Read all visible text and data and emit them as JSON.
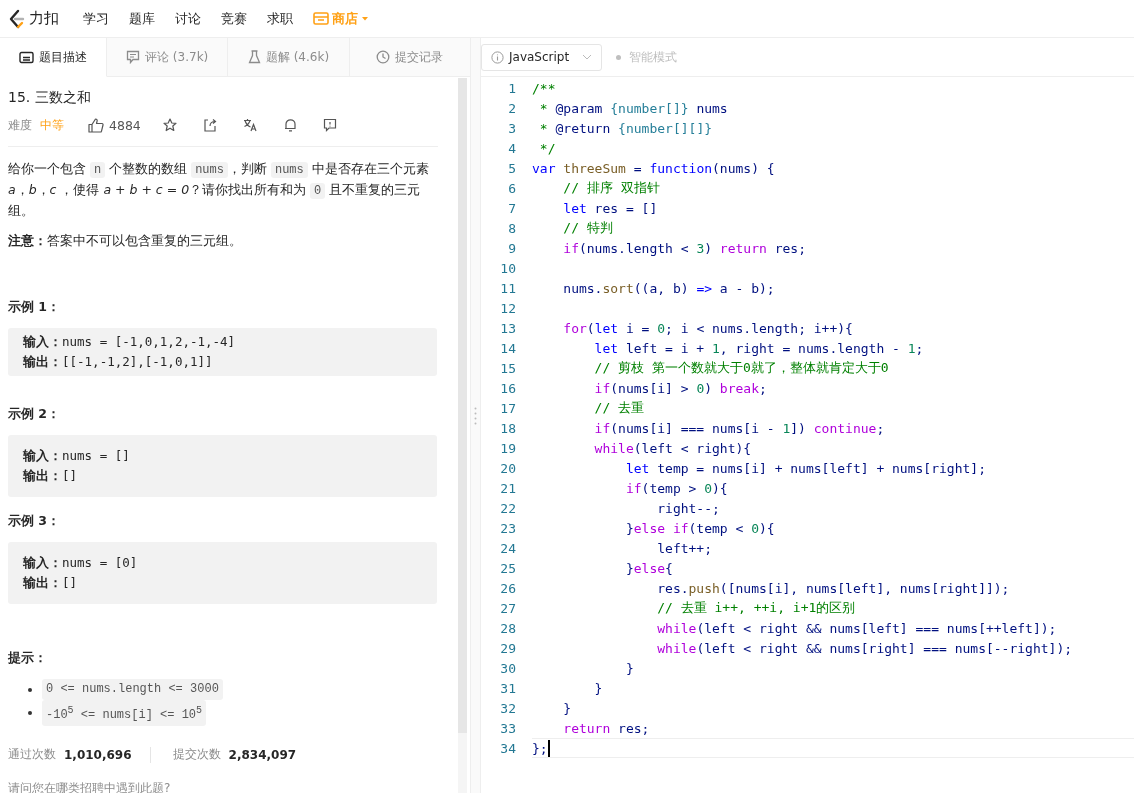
{
  "nav": {
    "logo": "力扣",
    "items": [
      {
        "label": "学习",
        "highlighted": false
      },
      {
        "label": "题库",
        "highlighted": false
      },
      {
        "label": "讨论",
        "highlighted": false
      },
      {
        "label": "竞赛",
        "highlighted": false
      },
      {
        "label": "求职",
        "highlighted": false
      },
      {
        "label": "商店",
        "highlighted": true
      }
    ]
  },
  "tabs": [
    {
      "label": "题目描述",
      "selected": true
    },
    {
      "label": "评论 (3.7k)",
      "selected": false
    },
    {
      "label": "题解 (4.6k)",
      "selected": false
    },
    {
      "label": "提交记录",
      "selected": false
    }
  ],
  "problem": {
    "title": "15. 三数之和",
    "difficulty_label": "难度",
    "difficulty": "中等",
    "likes": "4884",
    "description": [
      {
        "kind": "text",
        "text": "给你一个包含 "
      },
      {
        "kind": "code",
        "text": "n"
      },
      {
        "kind": "text",
        "text": " 个整数的数组 "
      },
      {
        "kind": "code",
        "text": "nums"
      },
      {
        "kind": "text",
        "text": "，判断 "
      },
      {
        "kind": "code",
        "text": "nums"
      },
      {
        "kind": "text",
        "text": " 中是否存在三个元素 *a*，*b*，*c* ，使得 *a + b + c = 0*？请你找出所有和为 "
      },
      {
        "kind": "code",
        "text": "0"
      },
      {
        "kind": "text",
        "text": " 且不重复的三元组。"
      }
    ],
    "note": "**注意：**答案中不可以包含重复的三元组。",
    "examples": [
      {
        "title": "示例 1：",
        "lines": [
          {
            "label": "输入：",
            "value": "nums = [-1,0,1,2,-1,-4]"
          },
          {
            "label": "输出：",
            "value": "[[-1,-1,2],[-1,0,1]]"
          }
        ]
      },
      {
        "title": "示例 2：",
        "lines": [
          {
            "label": "输入：",
            "value": "nums = []"
          },
          {
            "label": "输出：",
            "value": "[]"
          }
        ]
      },
      {
        "title": "示例 3：",
        "lines": [
          {
            "label": "输入：",
            "value": "nums = [0]"
          },
          {
            "label": "输出：",
            "value": "[]"
          }
        ]
      }
    ],
    "hints_title": "提示：",
    "hints": [
      "0 <= nums.length <= 3000",
      "-10$^{5}$ <= nums[i] <= 10$^{5}$"
    ],
    "stats": [
      {
        "label": "通过次数",
        "value": "1,010,696"
      },
      {
        "label": "提交次数",
        "value": "2,834,097"
      }
    ],
    "question": "请问您在哪类招聘中遇到此题?"
  },
  "editor": {
    "language": "JavaScript",
    "mode": {
      "label": "智能模式",
      "on": false
    },
    "lines": [
      {
        "number": "1",
        "active": false,
        "tokens": [
          {
            "kind": "cmt",
            "text": "/**"
          }
        ]
      },
      {
        "number": "2",
        "active": false,
        "tokens": [
          {
            "kind": "cmt",
            "text": " * "
          },
          {
            "kind": "plain",
            "text": "@param "
          },
          {
            "kind": "type",
            "text": "{number[]}"
          },
          {
            "kind": "plain",
            "text": " nums"
          }
        ]
      },
      {
        "number": "3",
        "active": false,
        "tokens": [
          {
            "kind": "cmt",
            "text": " * "
          },
          {
            "kind": "plain",
            "text": "@return "
          },
          {
            "kind": "type",
            "text": "{number[][]}"
          }
        ]
      },
      {
        "number": "4",
        "active": false,
        "tokens": [
          {
            "kind": "cmt",
            "text": " */"
          }
        ]
      },
      {
        "number": "5",
        "active": false,
        "tokens": [
          {
            "kind": "kw",
            "text": "var "
          },
          {
            "kind": "fn",
            "text": "threeSum"
          },
          {
            "kind": "plain",
            "text": " = "
          },
          {
            "kind": "kw",
            "text": "function"
          },
          {
            "kind": "plain",
            "text": "(nums) {"
          }
        ]
      },
      {
        "number": "6",
        "active": false,
        "tokens": [
          {
            "kind": "cmt",
            "text": "    // 排序 双指针"
          }
        ]
      },
      {
        "number": "7",
        "active": false,
        "tokens": [
          {
            "kind": "kw",
            "text": "    let"
          },
          {
            "kind": "plain",
            "text": " res = []"
          }
        ]
      },
      {
        "number": "8",
        "active": false,
        "tokens": [
          {
            "kind": "cmt",
            "text": "    // 特判"
          }
        ]
      },
      {
        "number": "9",
        "active": false,
        "tokens": [
          {
            "kind": "ctl",
            "text": "    if"
          },
          {
            "kind": "plain",
            "text": "(nums.length < "
          },
          {
            "kind": "num",
            "text": "3"
          },
          {
            "kind": "plain",
            "text": ") "
          },
          {
            "kind": "ctl",
            "text": "return"
          },
          {
            "kind": "plain",
            "text": " res;"
          }
        ]
      },
      {
        "number": "10",
        "active": false
      },
      {
        "number": "11",
        "active": false,
        "tokens": [
          {
            "kind": "plain",
            "text": "    nums."
          },
          {
            "kind": "fn",
            "text": "sort"
          },
          {
            "kind": "plain",
            "text": "((a, b) "
          },
          {
            "kind": "kw",
            "text": "=>"
          },
          {
            "kind": "plain",
            "text": " a - b);"
          }
        ]
      },
      {
        "number": "12",
        "active": false
      },
      {
        "number": "13",
        "active": false,
        "tokens": [
          {
            "kind": "ctl",
            "text": "    for"
          },
          {
            "kind": "plain",
            "text": "("
          },
          {
            "kind": "kw",
            "text": "let"
          },
          {
            "kind": "plain",
            "text": " i = "
          },
          {
            "kind": "num",
            "text": "0"
          },
          {
            "kind": "plain",
            "text": "; i < nums.length; i++){"
          }
        ]
      },
      {
        "number": "14",
        "active": false,
        "tokens": [
          {
            "kind": "kw",
            "text": "        let"
          },
          {
            "kind": "plain",
            "text": " left = i + "
          },
          {
            "kind": "num",
            "text": "1"
          },
          {
            "kind": "plain",
            "text": ", right = nums.length - "
          },
          {
            "kind": "num",
            "text": "1"
          },
          {
            "kind": "plain",
            "text": ";"
          }
        ]
      },
      {
        "number": "15",
        "active": false,
        "tokens": [
          {
            "kind": "cmt",
            "text": "        // 剪枝 第一个数就大于0就了，整体就肯定大于0"
          }
        ]
      },
      {
        "number": "16",
        "active": false,
        "tokens": [
          {
            "kind": "ctl",
            "text": "        if"
          },
          {
            "kind": "plain",
            "text": "(nums[i] > "
          },
          {
            "kind": "num",
            "text": "0"
          },
          {
            "kind": "plain",
            "text": ") "
          },
          {
            "kind": "ctl",
            "text": "break"
          },
          {
            "kind": "plain",
            "text": ";"
          }
        ]
      },
      {
        "number": "17",
        "active": false,
        "tokens": [
          {
            "kind": "cmt",
            "text": "        // 去重"
          }
        ]
      },
      {
        "number": "18",
        "active": false,
        "tokens": [
          {
            "kind": "ctl",
            "text": "        if"
          },
          {
            "kind": "plain",
            "text": "(nums[i] === nums[i - "
          },
          {
            "kind": "num",
            "text": "1"
          },
          {
            "kind": "plain",
            "text": "]) "
          },
          {
            "kind": "ctl",
            "text": "continue"
          },
          {
            "kind": "plain",
            "text": ";"
          }
        ]
      },
      {
        "number": "19",
        "active": false,
        "tokens": [
          {
            "kind": "ctl",
            "text": "        while"
          },
          {
            "kind": "plain",
            "text": "(left < right){"
          }
        ]
      },
      {
        "number": "20",
        "active": false,
        "tokens": [
          {
            "kind": "kw",
            "text": "            let"
          },
          {
            "kind": "plain",
            "text": " temp = nums[i] + nums[left] + nums[right];"
          }
        ]
      },
      {
        "number": "21",
        "active": false,
        "tokens": [
          {
            "kind": "ctl",
            "text": "            if"
          },
          {
            "kind": "plain",
            "text": "(temp > "
          },
          {
            "kind": "num",
            "text": "0"
          },
          {
            "kind": "plain",
            "text": "){"
          }
        ]
      },
      {
        "number": "22",
        "active": false,
        "tokens": [
          {
            "kind": "plain",
            "text": "                right--;"
          }
        ]
      },
      {
        "number": "23",
        "active": false,
        "tokens": [
          {
            "kind": "plain",
            "text": "            }"
          },
          {
            "kind": "ctl",
            "text": "else if"
          },
          {
            "kind": "plain",
            "text": "(temp < "
          },
          {
            "kind": "num",
            "text": "0"
          },
          {
            "kind": "plain",
            "text": "){"
          }
        ]
      },
      {
        "number": "24",
        "active": false,
        "tokens": [
          {
            "kind": "plain",
            "text": "                left++;"
          }
        ]
      },
      {
        "number": "25",
        "active": false,
        "tokens": [
          {
            "kind": "plain",
            "text": "            }"
          },
          {
            "kind": "ctl",
            "text": "else"
          },
          {
            "kind": "plain",
            "text": "{"
          }
        ]
      },
      {
        "number": "26",
        "active": false,
        "tokens": [
          {
            "kind": "plain",
            "text": "                res."
          },
          {
            "kind": "fn",
            "text": "push"
          },
          {
            "kind": "plain",
            "text": "([nums[i], nums[left], nums[right]]);"
          }
        ]
      },
      {
        "number": "27",
        "active": false,
        "tokens": [
          {
            "kind": "cmt",
            "text": "                // 去重 i++, ++i, i+1的区别"
          }
        ]
      },
      {
        "number": "28",
        "active": false,
        "tokens": [
          {
            "kind": "ctl",
            "text": "                while"
          },
          {
            "kind": "plain",
            "text": "(left < right && nums[left] === nums[++left]);"
          }
        ]
      },
      {
        "number": "29",
        "active": false,
        "tokens": [
          {
            "kind": "ctl",
            "text": "                while"
          },
          {
            "kind": "plain",
            "text": "(left < right && nums[right] === nums[--right]);"
          }
        ]
      },
      {
        "number": "30",
        "active": false,
        "tokens": [
          {
            "kind": "plain",
            "text": "            }"
          }
        ]
      },
      {
        "number": "31",
        "active": false,
        "tokens": [
          {
            "kind": "plain",
            "text": "        }"
          }
        ]
      },
      {
        "number": "32",
        "active": false,
        "tokens": [
          {
            "kind": "plain",
            "text": "    }"
          }
        ]
      },
      {
        "number": "33",
        "active": false,
        "tokens": [
          {
            "kind": "ctl",
            "text": "    return"
          },
          {
            "kind": "plain",
            "text": " res;"
          }
        ]
      },
      {
        "number": "34",
        "active": true,
        "tokens": [
          {
            "kind": "plain",
            "text": "};"
          }
        ]
      }
    ]
  }
}
